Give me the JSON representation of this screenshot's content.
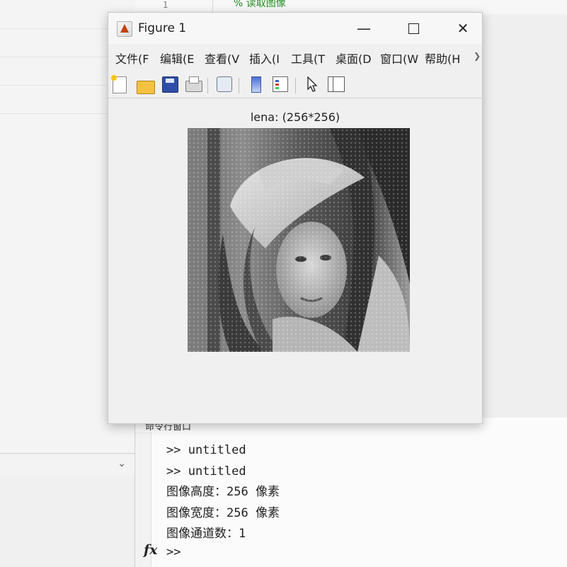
{
  "editor": {
    "line_number": "1",
    "code_comment": "% 读取图像"
  },
  "figure": {
    "title": "Figure 1",
    "window_controls": {
      "minimize": "—",
      "close": "✕"
    },
    "menu": [
      {
        "label": "文件(F"
      },
      {
        "label": "编辑(E"
      },
      {
        "label": "查看(V"
      },
      {
        "label": "插入(I"
      },
      {
        "label": "工具(T"
      },
      {
        "label": "桌面(D"
      },
      {
        "label": "窗口(W"
      },
      {
        "label": "帮助(H"
      }
    ],
    "toolbar_icons": [
      "new-figure-icon",
      "open-file-icon",
      "save-icon",
      "print-icon",
      "link-plot-icon",
      "colorbar-icon",
      "legend-icon",
      "edit-pointer-icon",
      "property-pane-icon"
    ],
    "axes_title": "lena: (256*256)"
  },
  "command_window": {
    "title": "命令行窗口",
    "lines": [
      ">> untitled",
      ">> untitled",
      "图像高度：256 像素",
      "图像宽度：256 像素",
      "图像通道数：1"
    ],
    "prompt": ">>",
    "fx_label": "fx"
  }
}
